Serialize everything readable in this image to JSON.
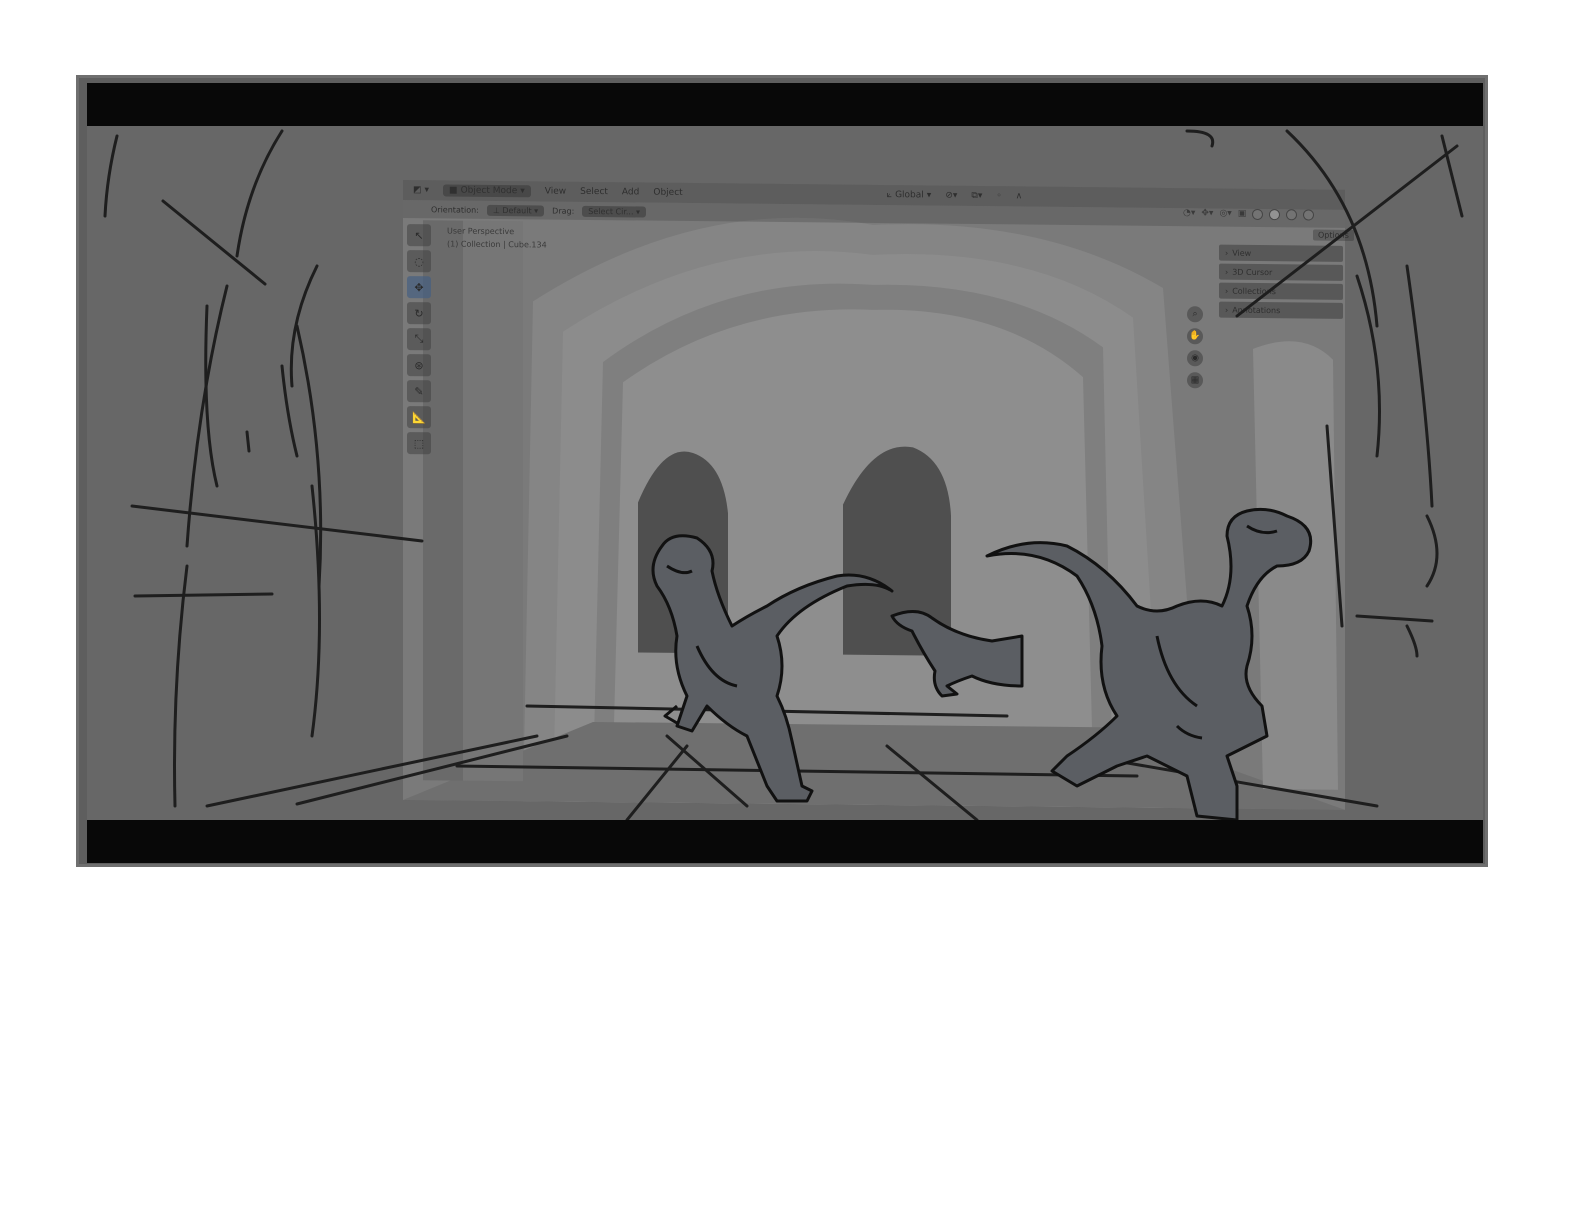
{
  "viewport": {
    "header": {
      "editor_icon": "3d-viewport-icon",
      "mode": "Object Mode",
      "menus": [
        "View",
        "Select",
        "Add",
        "Object"
      ],
      "transform_orientation": "Global"
    },
    "subheader": {
      "orientation_label": "Orientation:",
      "orientation_value": "Default",
      "drag_label": "Drag:",
      "drag_value": "Select Cir..."
    },
    "overlay": {
      "perspective": "User Perspective",
      "collection": "(1) Collection | Cube.134"
    },
    "options_label": "Options",
    "npanel": [
      "View",
      "3D Cursor",
      "Collections",
      "Annotations"
    ],
    "toolbar_icons": [
      "cursor-icon",
      "select-circle-icon",
      "move-icon",
      "rotate-icon",
      "scale-icon",
      "transform-icon",
      "annotate-icon",
      "measure-icon",
      "add-cube-icon"
    ],
    "active_tool": 2
  },
  "colors": {
    "letterbox": "#080808",
    "scene_bg": "#676767",
    "sketch_line": "#1e1e1e",
    "dino_fill": "#5b5e63"
  }
}
